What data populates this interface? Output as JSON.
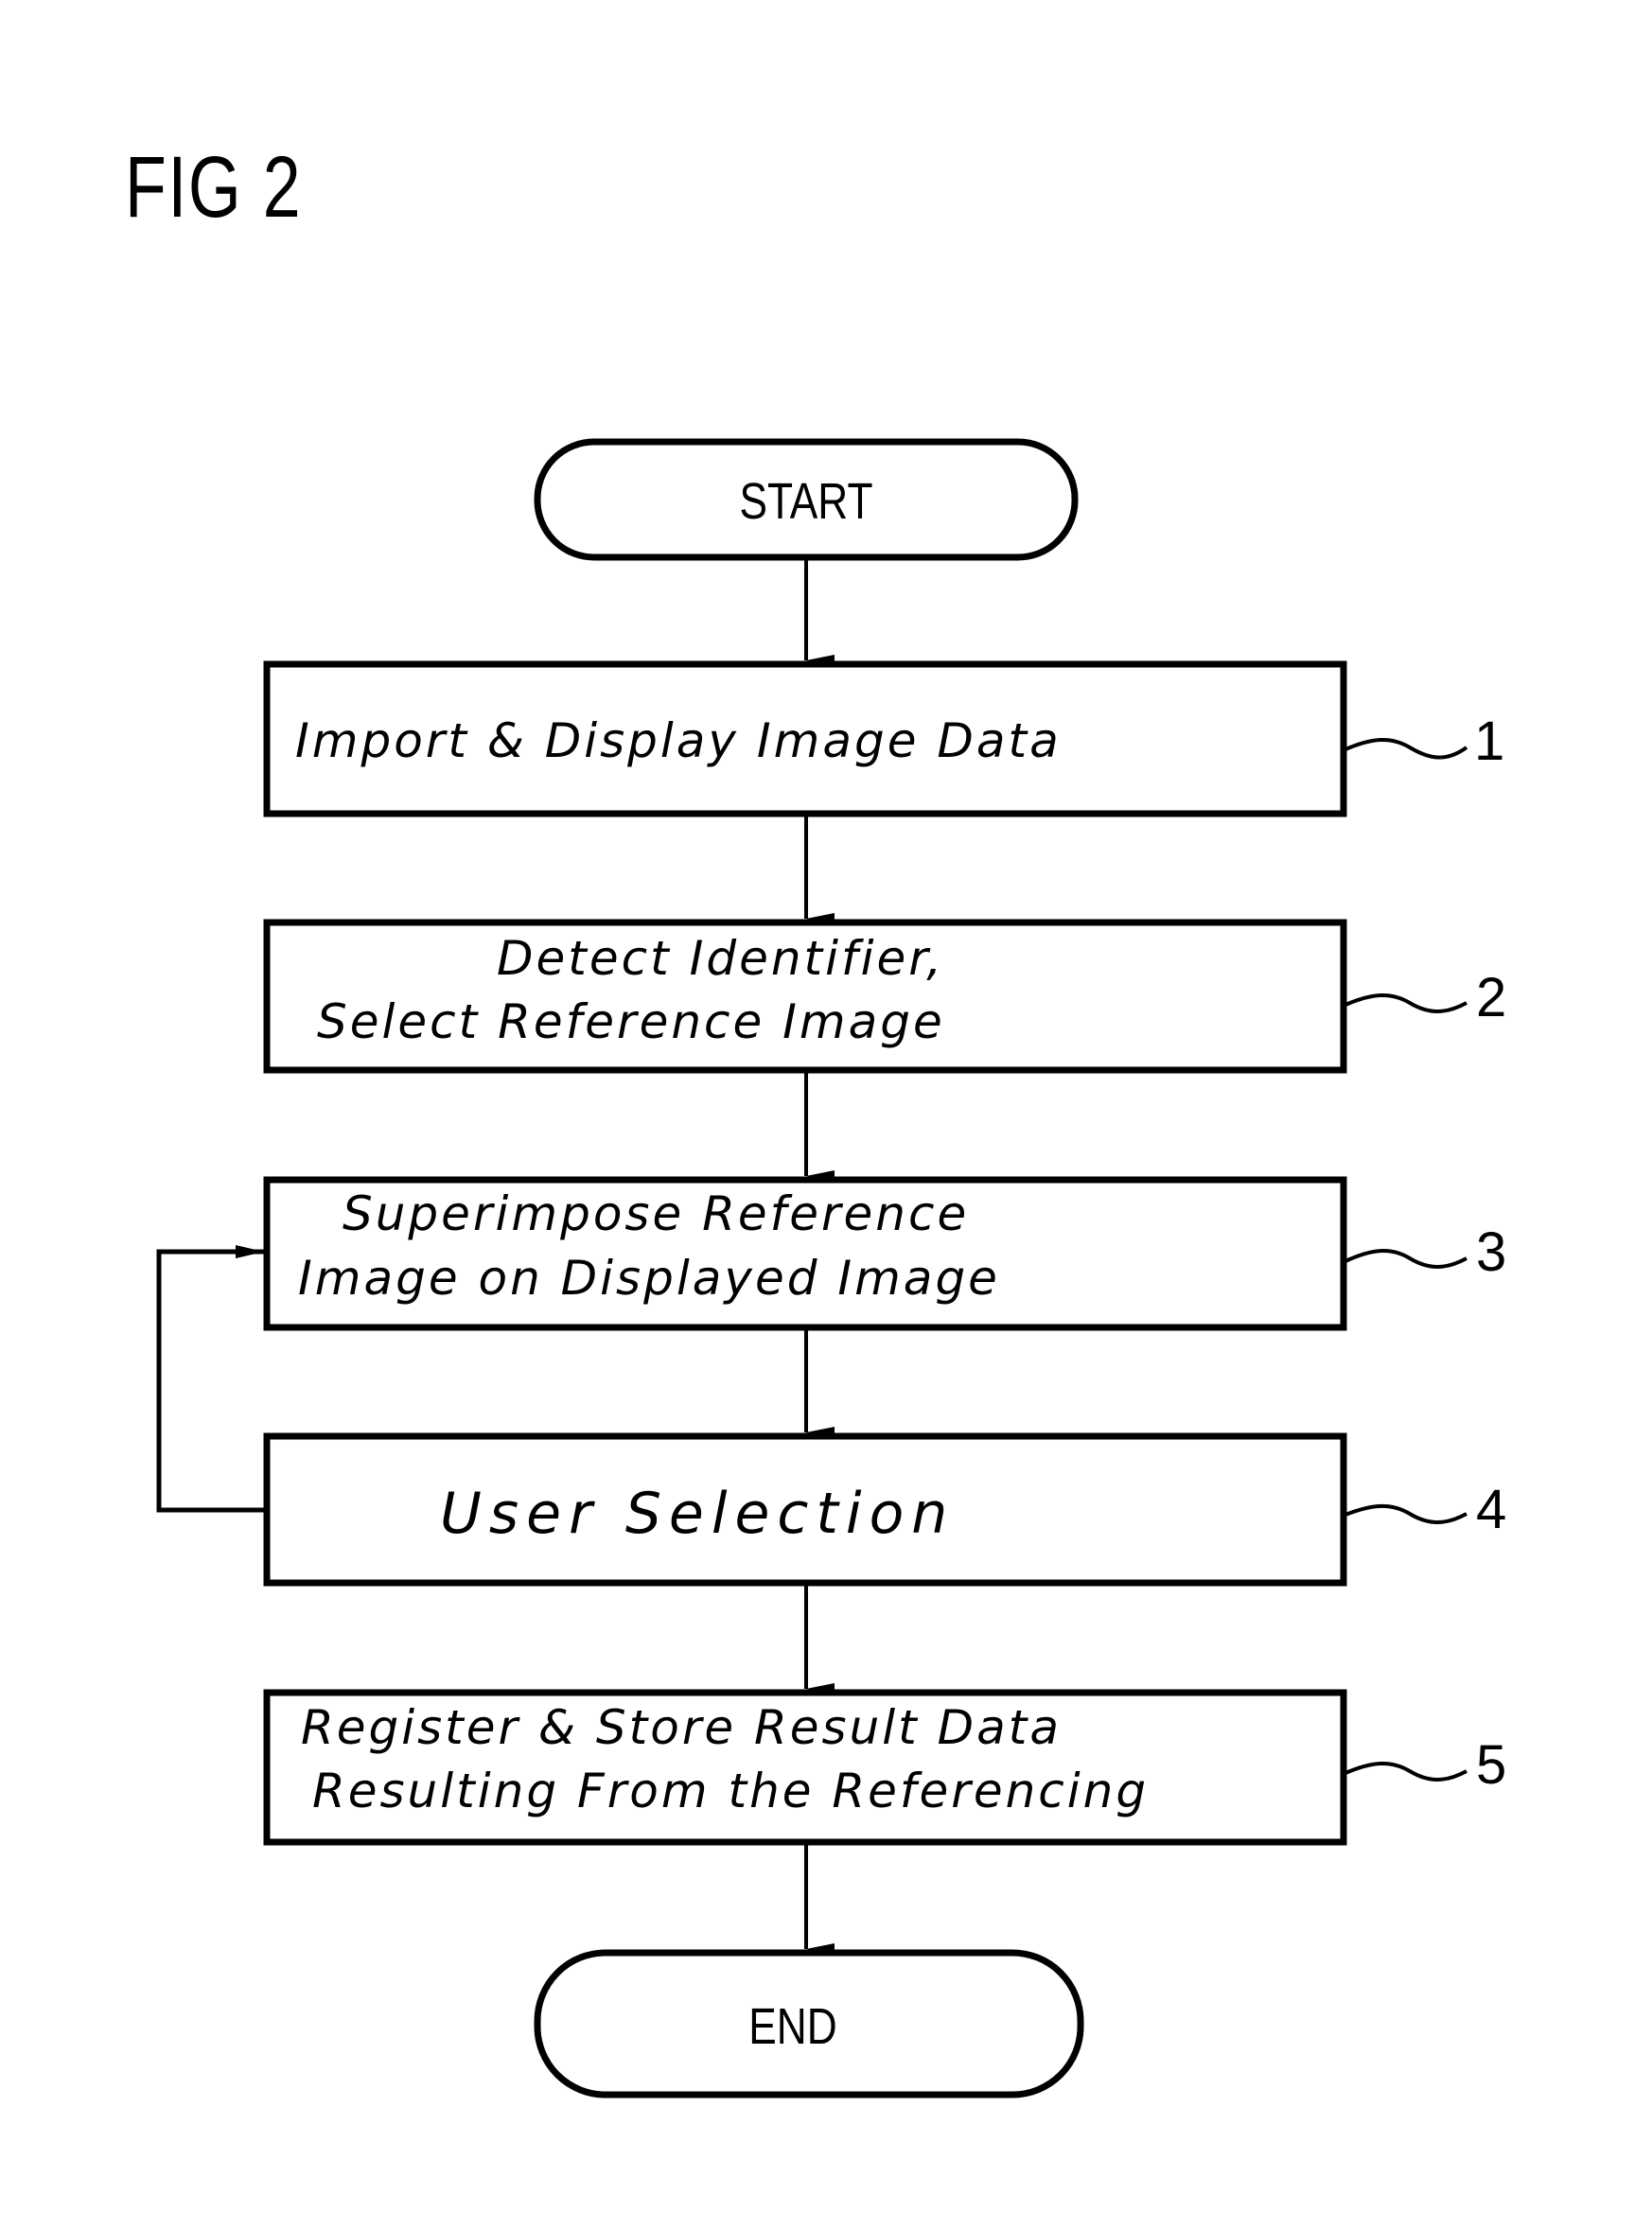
{
  "figure": {
    "title": "FIG 2"
  },
  "flowchart": {
    "start": {
      "label": "START"
    },
    "end": {
      "label": "END"
    },
    "steps": [
      {
        "ref": "1",
        "lines": [
          "Import & Display Image Data"
        ]
      },
      {
        "ref": "2",
        "lines": [
          "Detect Identifier,",
          "Select Reference Image"
        ]
      },
      {
        "ref": "3",
        "lines": [
          "Superimpose Reference",
          "Image on Displayed Image"
        ]
      },
      {
        "ref": "4",
        "lines": [
          "User Selection"
        ]
      },
      {
        "ref": "5",
        "lines": [
          "Register & Store Result Data",
          "Resulting From the Referencing"
        ]
      }
    ],
    "loop": {
      "from_step": "4",
      "to_step": "3"
    },
    "colors": {
      "stroke": "#000000",
      "background": "#ffffff"
    }
  }
}
